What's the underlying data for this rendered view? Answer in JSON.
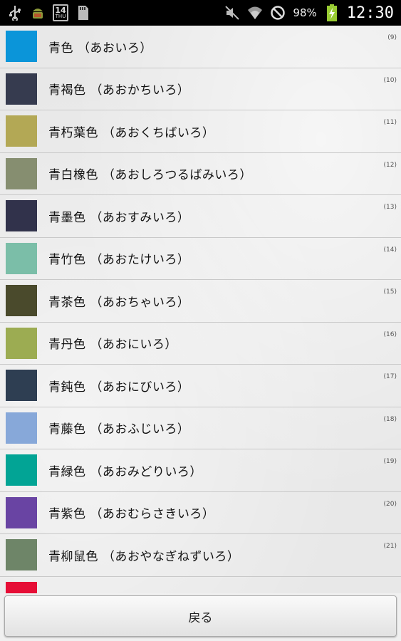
{
  "status_bar": {
    "calendar_day": "14",
    "calendar_weekday": "THU",
    "battery_percent": "98%",
    "time": "12:30",
    "icons": [
      "usb-icon",
      "android-debug-icon",
      "calendar-icon",
      "sd-card-icon",
      "mute-icon",
      "wifi-icon",
      "no-signal-icon",
      "battery-charging-icon"
    ]
  },
  "colors": [
    {
      "name": "青色 （あおいろ）",
      "index": "(9)",
      "hex": "#0b95d9"
    },
    {
      "name": "青褐色 （あおかちいろ）",
      "index": "(10)",
      "hex": "#363b4f"
    },
    {
      "name": "青朽葉色 （あおくちばいろ）",
      "index": "(11)",
      "hex": "#b3a855"
    },
    {
      "name": "青白橡色 （あおしろつるばみいろ）",
      "index": "(12)",
      "hex": "#868e70"
    },
    {
      "name": "青墨色 （あおすみいろ）",
      "index": "(13)",
      "hex": "#31324b"
    },
    {
      "name": "青竹色 （あおたけいろ）",
      "index": "(14)",
      "hex": "#7bbea8"
    },
    {
      "name": "青茶色 （あおちゃいろ）",
      "index": "(15)",
      "hex": "#4a4a2c"
    },
    {
      "name": "青丹色 （あおにいろ）",
      "index": "(16)",
      "hex": "#9cac52"
    },
    {
      "name": "青鈍色 （あおにびいろ）",
      "index": "(17)",
      "hex": "#2e3e52"
    },
    {
      "name": "青藤色 （あおふじいろ）",
      "index": "(18)",
      "hex": "#87a8d9"
    },
    {
      "name": "青緑色 （あおみどりいろ）",
      "index": "(19)",
      "hex": "#02a495"
    },
    {
      "name": "青紫色 （あおむらさきいろ）",
      "index": "(20)",
      "hex": "#6944a3"
    },
    {
      "name": "青柳鼠色 （あおやなぎねずいろ）",
      "index": "(21)",
      "hex": "#6e8568"
    },
    {
      "name": "",
      "index": "",
      "hex": "#e60e36"
    }
  ],
  "footer": {
    "back_label": "戻る"
  }
}
